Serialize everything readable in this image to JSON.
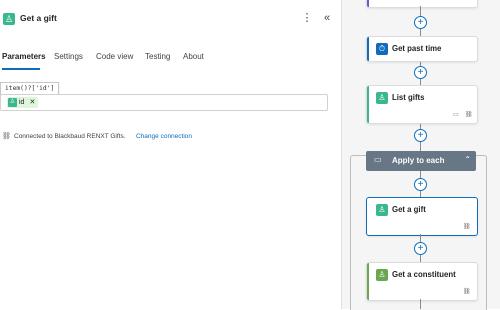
{
  "panel": {
    "title": "Get a gift",
    "more_label": "⋮",
    "collapse_label": "«"
  },
  "tabs": [
    {
      "label": "Parameters",
      "active": true
    },
    {
      "label": "Settings",
      "active": false
    },
    {
      "label": "Code view",
      "active": false
    },
    {
      "label": "Testing",
      "active": false
    },
    {
      "label": "About",
      "active": false
    }
  ],
  "parameter": {
    "tooltip": "item()?['id']",
    "token_label": "id",
    "token_remove": "✕"
  },
  "connection": {
    "text": "Connected to Blackbaud RENXT Gifts.",
    "change_label": "Change connection"
  },
  "flow": {
    "steps": [
      {
        "title": "Get past time",
        "icon": "clock-icon",
        "color": "#0f6cbd"
      },
      {
        "title": "List gifts",
        "icon": "gift-app-icon",
        "color": "#3bb78f"
      },
      {
        "title": "Get a gift",
        "icon": "gift-app-icon",
        "color": "#3bb78f"
      },
      {
        "title": "Get a constituent",
        "icon": "constituent-app-icon",
        "color": "#6aa84f"
      }
    ],
    "scope": {
      "title": "Apply to each",
      "icon": "loop-icon",
      "color": "#687786"
    }
  },
  "colors": {
    "accent": "#0f6cbd",
    "brand_green": "#3bb78f"
  }
}
